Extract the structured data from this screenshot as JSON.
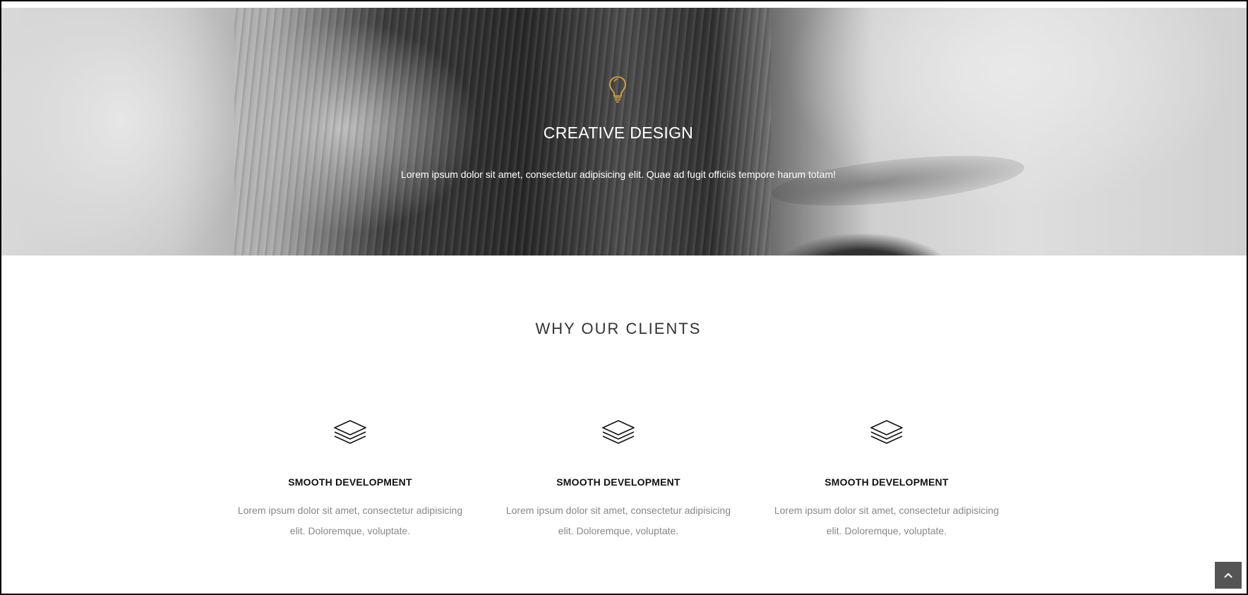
{
  "hero": {
    "icon": "lightbulb-icon",
    "accent_color": "#d4a340",
    "title": "CREATIVE DESIGN",
    "text": "Lorem ipsum dolor sit amet, consectetur adipisicing elit. Quae ad fugit officiis tempore harum totam!"
  },
  "section": {
    "title": "WHY OUR CLIENTS",
    "features": [
      {
        "icon": "layers-icon",
        "title": "SMOOTH DEVELOPMENT",
        "text": "Lorem ipsum dolor sit amet, consectetur adipisicing elit. Doloremque, voluptate."
      },
      {
        "icon": "layers-icon",
        "title": "SMOOTH DEVELOPMENT",
        "text": "Lorem ipsum dolor sit amet, consectetur adipisicing elit. Doloremque, voluptate."
      },
      {
        "icon": "layers-icon",
        "title": "SMOOTH DEVELOPMENT",
        "text": "Lorem ipsum dolor sit amet, consectetur adipisicing elit. Doloremque, voluptate."
      }
    ]
  },
  "scroll_top": {
    "icon": "chevron-up-icon"
  }
}
